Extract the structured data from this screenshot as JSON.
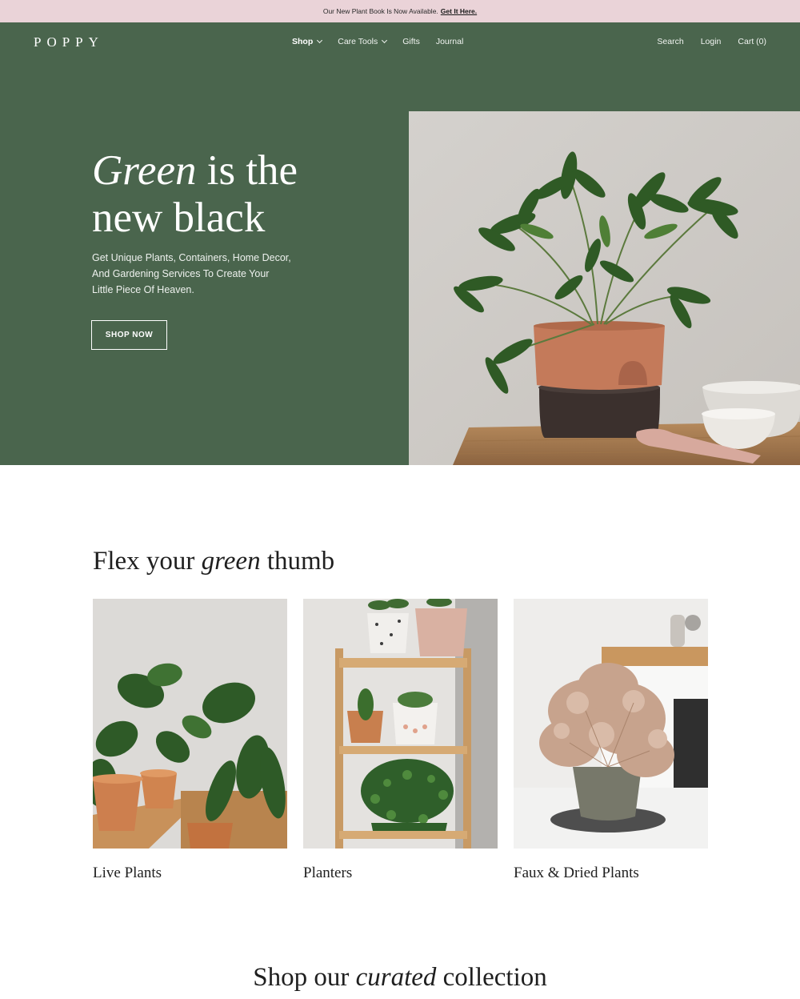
{
  "announcement": {
    "text": "Our New Plant Book Is Now Available.",
    "link": "Get It Here."
  },
  "brand": {
    "logo": "POPPY"
  },
  "nav": {
    "items": [
      {
        "label": "Shop",
        "has_dropdown": true,
        "active": true
      },
      {
        "label": "Care Tools",
        "has_dropdown": true,
        "active": false
      },
      {
        "label": "Gifts",
        "has_dropdown": false,
        "active": false
      },
      {
        "label": "Journal",
        "has_dropdown": false,
        "active": false
      }
    ],
    "right": {
      "search": "Search",
      "login": "Login",
      "cart": "Cart (0)"
    }
  },
  "hero": {
    "title_em": "Green",
    "title_rest1": "is the",
    "title_line2": "new black",
    "subtitle": "Get Unique Plants, Containers, Home Decor, And Gardening Services To Create Your Little Piece Of Heaven.",
    "button": "SHOP NOW"
  },
  "categories_section": {
    "title_pre": "Flex your",
    "title_em": "green",
    "title_post": "thumb",
    "cards": [
      {
        "label": "Live Plants"
      },
      {
        "label": "Planters"
      },
      {
        "label": "Faux & Dried Plants"
      }
    ]
  },
  "collection_section": {
    "title_pre": "Shop our",
    "title_em": "curated",
    "title_post": "collection"
  },
  "colors": {
    "announcement_bg": "#ead3d8",
    "header_green": "#4a654d",
    "text_dark": "#1f1f1f"
  },
  "icons": [
    "chevron-down-icon"
  ]
}
